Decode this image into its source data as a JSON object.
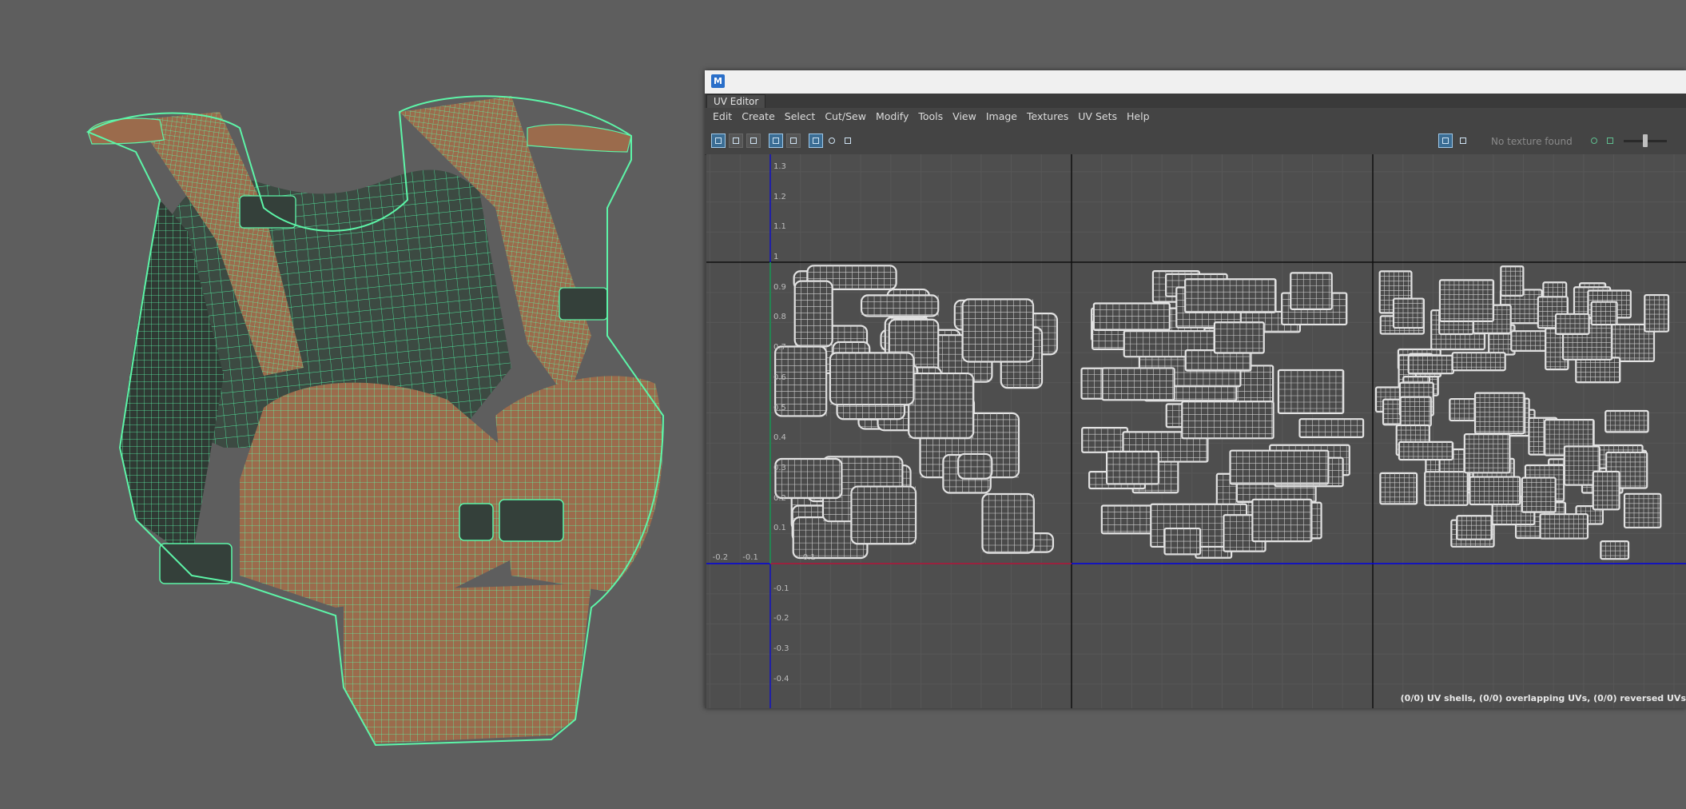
{
  "window": {
    "app_icon_letter": "M",
    "panel_tab": "UV Editor"
  },
  "menu": [
    "Edit",
    "Create",
    "Select",
    "Cut/Sew",
    "Modify",
    "Tools",
    "View",
    "Image",
    "Textures",
    "UV Sets",
    "Help"
  ],
  "toolbar": {
    "texture_field": "No texture found",
    "icons": [
      "uv-shell-icon",
      "uv-components-icon",
      "uv-stack-icon",
      "grid-snap-icon",
      "pixel-snap-icon",
      "checker-icon",
      "camera-icon",
      "image-display-icon",
      "checkerboard-icon",
      "dropdown-arrow-icon",
      "refresh-icon",
      "image-icon",
      "collapse-icon"
    ]
  },
  "uv_axes": {
    "v_ticks": [
      "1.3",
      "1.2",
      "1.1",
      "1",
      "0.9",
      "0.8",
      "0.7",
      "0.6",
      "0.5",
      "0.4",
      "0.3",
      "0.2",
      "0.1",
      "-0.1",
      "-0.2",
      "-0.3",
      "-0.4"
    ],
    "u_ticks": [
      "-0.2",
      "-0.1",
      "0.1"
    ]
  },
  "status_text": "(0/0) UV shells, (0/0) overlapping UVs, (0/0) reversed UVs",
  "colors": {
    "wire": "#5df5a8",
    "surface": "#9b6b4c",
    "uv_shell": "#e3e3e3",
    "u_axis": "#0000e0",
    "v_axis": "#1010c0",
    "tile_border": "#111111"
  }
}
